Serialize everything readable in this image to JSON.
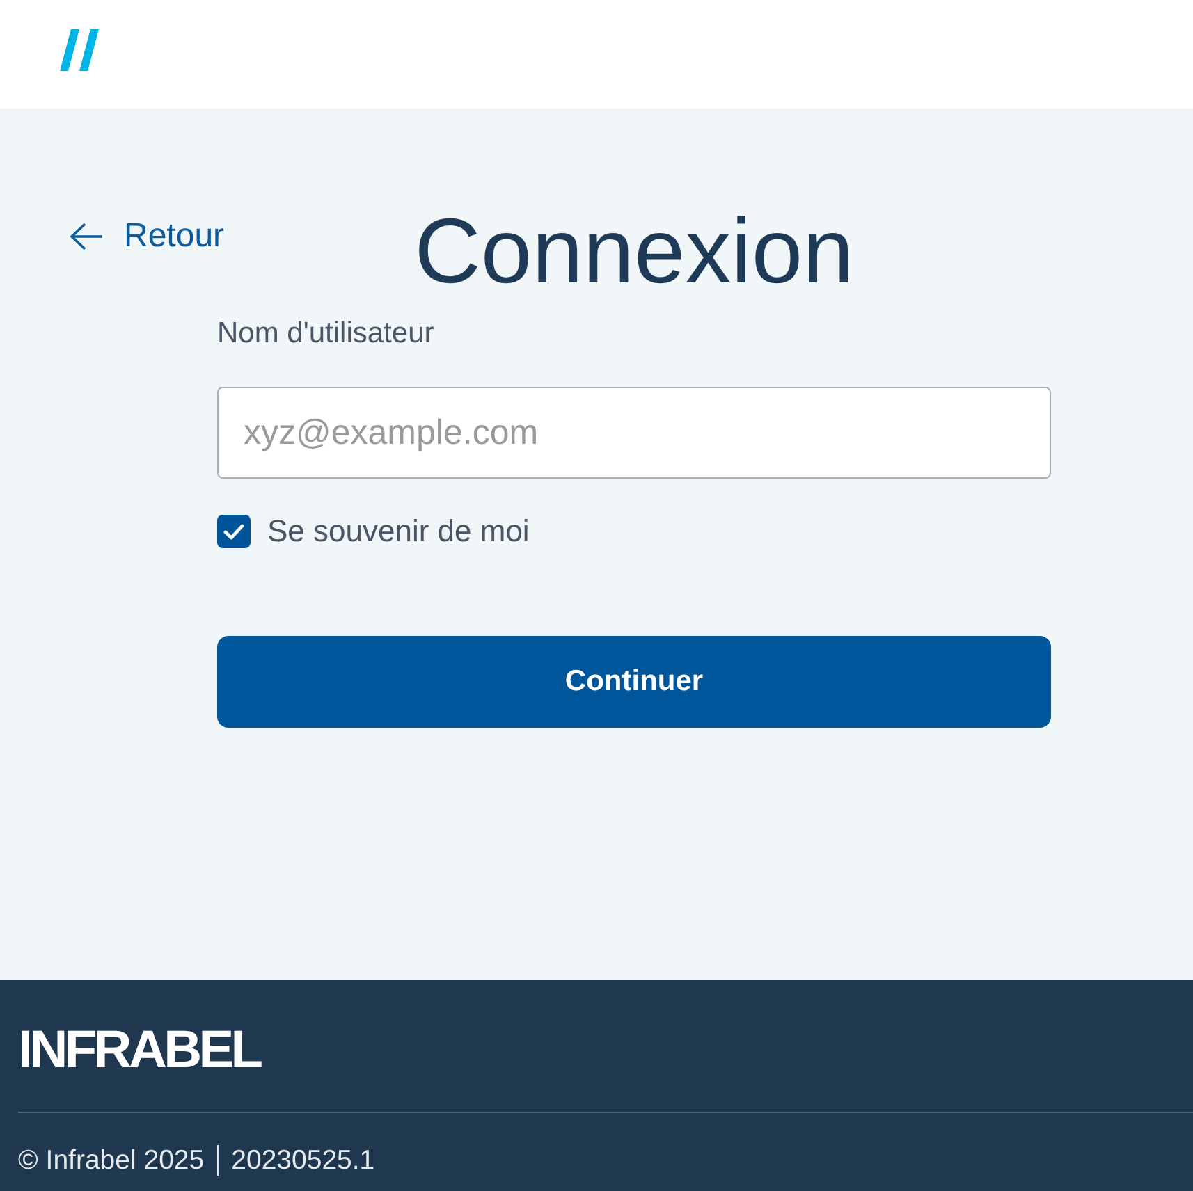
{
  "back_link": {
    "label": "Retour"
  },
  "title": "Connexion",
  "form": {
    "username": {
      "label": "Nom d'utilisateur",
      "placeholder": "xyz@example.com"
    },
    "remember_me": {
      "label": "Se souvenir de moi",
      "checked": true
    },
    "submit": {
      "label": "Continuer"
    }
  },
  "footer": {
    "logo": "INFRABEL",
    "copyright": "© Infrabel 2025",
    "version": "20230525.1"
  }
}
